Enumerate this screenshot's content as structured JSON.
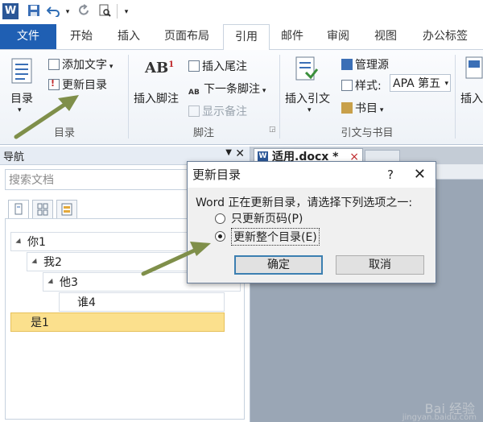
{
  "qat": {
    "undo_sep": "▾"
  },
  "tabs": [
    "文件",
    "开始",
    "插入",
    "页面布局",
    "引用",
    "邮件",
    "审阅",
    "视图",
    "办公标签"
  ],
  "ribbon": {
    "toc": {
      "big_label": "目录",
      "add_text": "添加文字",
      "update_toc": "更新目录",
      "group": "目录"
    },
    "footnote": {
      "insert_footnote": "插入脚注",
      "insert_endnote": "插入尾注",
      "next_footnote": "下一条脚注",
      "show_notes": "显示备注",
      "group": "脚注",
      "ab_label": "AB"
    },
    "citation": {
      "insert_citation": "插入引文",
      "manage_sources": "管理源",
      "style_label": "样式:",
      "style_value": "APA 第五",
      "bibliography": "书目",
      "group": "引文与书目"
    },
    "extra": {
      "partial_label": "插入"
    }
  },
  "nav": {
    "title": "导航",
    "search_placeholder": "搜索文档",
    "tree": [
      {
        "label": "你1",
        "level": 1
      },
      {
        "label": "我2",
        "level": 2
      },
      {
        "label": "他3",
        "level": 3
      },
      {
        "label": "谁4",
        "level": 4
      },
      {
        "label": "是1",
        "level": 0,
        "selected": true
      }
    ]
  },
  "document": {
    "tab_title": "适用.docx *",
    "tab_close": "×"
  },
  "dialog": {
    "title": "更新目录",
    "help": "?",
    "close": "✕",
    "prompt": "Word 正在更新目录，请选择下列选项之一:",
    "option_pages": "只更新页码(P)",
    "option_all": "更新整个目录(E)",
    "selected": "option_all",
    "ok": "确定",
    "cancel": "取消"
  },
  "watermark": {
    "brand": "Bai 经验",
    "url": "jingyan.baidu.com"
  },
  "colors": {
    "file_tab": "#1f5fb3",
    "arrow": "#7f8f4a",
    "selected_node": "#fbe08d"
  }
}
